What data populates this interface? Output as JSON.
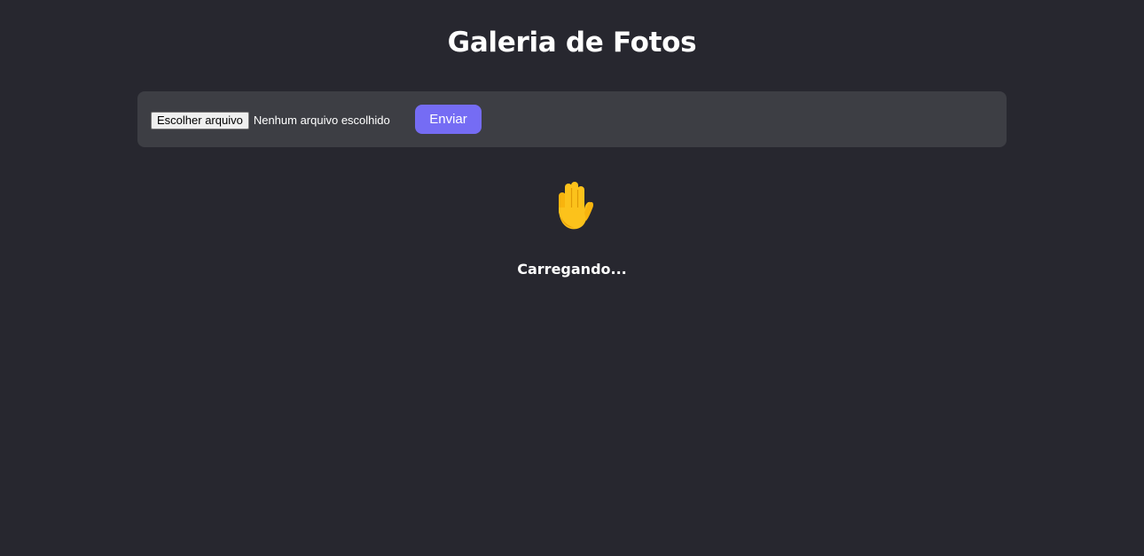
{
  "header": {
    "title": "Galeria de Fotos"
  },
  "upload": {
    "choose_file_label": "Escolher arquivo",
    "file_status": "Nenhum arquivo escolhido",
    "send_label": "Enviar"
  },
  "loading": {
    "icon": "raised-hand-icon",
    "text": "Carregando..."
  },
  "colors": {
    "background": "#27272f",
    "panel": "#3d3e44",
    "accent": "#756cf4",
    "text": "#ffffff"
  }
}
